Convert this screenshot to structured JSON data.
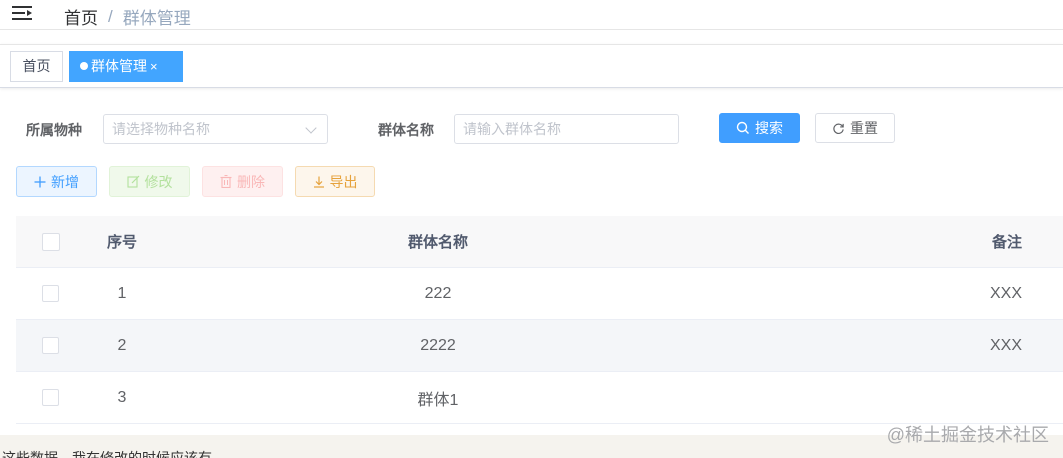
{
  "navbar": {
    "breadcrumb": {
      "home": "首页",
      "separator": "/",
      "current": "群体管理"
    }
  },
  "tags": [
    {
      "label": "首页"
    },
    {
      "label": "群体管理",
      "close": "×"
    }
  ],
  "search_form": {
    "species_label": "所属物种",
    "species_placeholder": "请选择物种名称",
    "group_label": "群体名称",
    "group_placeholder": "请输入群体名称",
    "search_button": "搜索",
    "reset_button": "重置"
  },
  "toolbar": {
    "add": "新增",
    "edit": "修改",
    "delete": "删除",
    "export": "导出"
  },
  "table": {
    "columns": [
      "序号",
      "群体名称",
      "备注"
    ],
    "rows": [
      {
        "index": "1",
        "name": "222",
        "note": "XXX"
      },
      {
        "index": "2",
        "name": "2222",
        "note": "XXX"
      },
      {
        "index": "3",
        "name": "群体1",
        "note": ""
      }
    ]
  },
  "footer": {
    "partial_text": "这些数据，我在修改的时候应该有",
    "watermark": "@稀土掘金技术社区"
  },
  "colors": {
    "primary": "#409eff",
    "active_tag": "#42a5ff",
    "success_light": "#f0f9eb",
    "danger_light": "#fef0f0",
    "warning": "#e6a23c"
  }
}
